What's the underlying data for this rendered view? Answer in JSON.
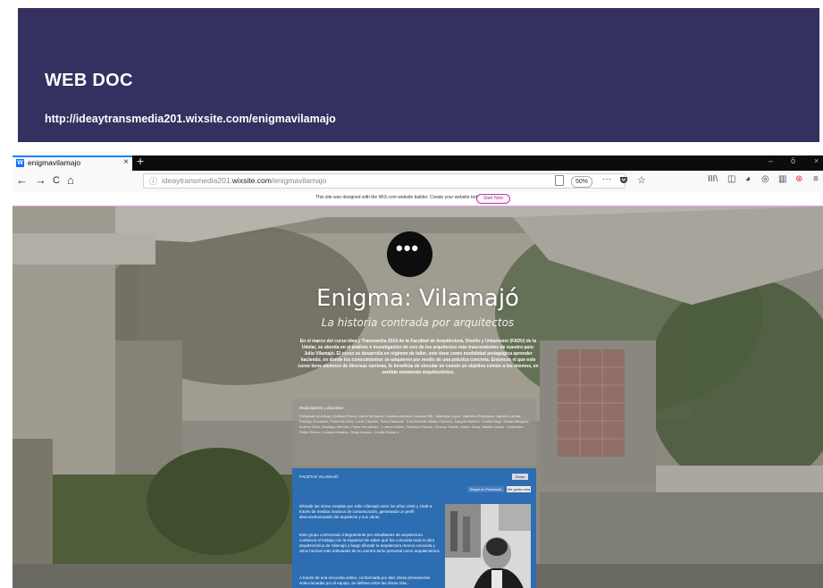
{
  "slide": {
    "title": "WEB DOC",
    "url": "http://ideaytransmedia201.wixsite.com/enigmavilamajo"
  },
  "browser": {
    "tab_title": "enigmavilamajo",
    "tab_close": "×",
    "new_tab": "+",
    "win_min": "–",
    "win_max": "ō",
    "win_close": "×",
    "back": "←",
    "forward": "→",
    "reload": "C",
    "home": "⌂",
    "url_info": "ⓘ",
    "url_host_prefix": "ideaytransmedia201.",
    "url_host_bold": "wixsite.com",
    "url_path": "/enigmavilamajo",
    "zoom": "50%",
    "more": "···",
    "star": "☆",
    "tools": [
      "III\\",
      "◫",
      "◕",
      "◎",
      "▥",
      "⊛",
      "≡"
    ]
  },
  "banner": {
    "text": "This site was designed with the WIX.com website builder. Create your website today.",
    "button": "Start Now"
  },
  "site": {
    "logo_dots": "•••",
    "title": "Enigma: Vilamajó",
    "subtitle": "La historia contrada por arquitectos",
    "intro": "En el marco del curso Idea y Transmedia 2019 de la Facultad de Arquitectura, Diseño y Urbanismo (FADU) de la Udelar, se aborda en el análisis e investigación de uno de los arquitectos más trascendentes de nuestro país: Julio Vilamajó. El curso se desarrolla en régimen de taller, este tiene como modalidad pedagógica aprender haciendo, en donde los conocimientos se adquieren por medio de una práctica concreta. Entonces el que este curso tiene alumnos de diversas carreras, lo beneficia de vincular en común un objetivo común a los mismos, en sentido netamente arquitectónico.",
    "credits_heading": "Realizadores y docentes",
    "credits": "Fernanda Urumingo, Bolivian Pozzo, Karen Mendoza, Carolina Acosta, Facundo Hill · Manuela López, Valentina Rodríguez, Agustín Lamas, Rodrigo Gonzalez, Florencia Ortiz, Lucía Cáceres, Sofía Sarasola · Inés Berrutti, Mateo Cabrera, Joaquín Bianchi, Camila Vega, Daniel Márquez, Andrea Silva, Santiago Méndez, Paula Fernández · Lorena Núñez, Federico Ramos, Gimena Toledo, Martín Sosa, Natalia Castro · Docentes: Pablo Rivero, Luciana Morales, Diego Alvarez, Cecilia Romero",
    "panel_heading": "FACETAS VILAMAJÓ",
    "panel_share": "Share",
    "panel_like": "Seguir en Facebook",
    "panel_follow": "Me gusta esta",
    "panel_paragraphs": [
      "Difundir las obras creadas por Julio Vilamajó entre los años 1925 y 1948 a través de medios masivos de comunicación, generando un perfil desconstructurado del arquitecto y sus obras.",
      "Este grupo conformado íntegramente por estudiantes de arquitectura comienza el trabajo con la inquietud de saber qué fue conocida toda la obra arquitectónica de Vilamajó y luego difundir la arquitectura menos conocida y otros hechos más relevantes de su carrera tanto personal como arquitectónica.",
      "A través de una encuesta online, conformada por diez obras previamente seleccionadas por el equipo, se definen entre las obras más..."
    ]
  }
}
